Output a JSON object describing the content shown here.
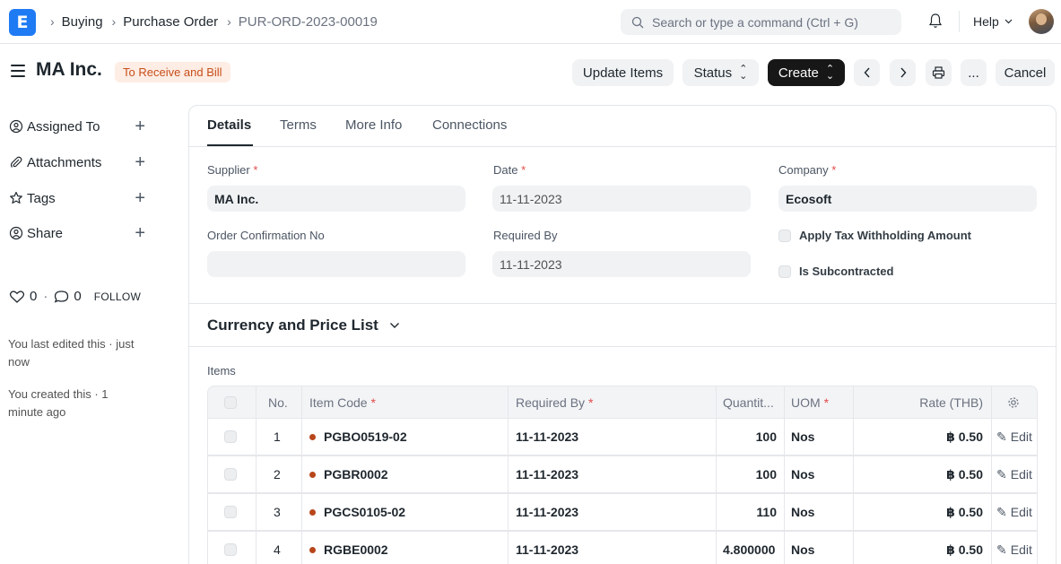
{
  "navbar": {
    "logo": "E",
    "breadcrumbs": [
      "Buying",
      "Purchase Order",
      "PUR-ORD-2023-00019"
    ],
    "search_placeholder": "Search or type a command (Ctrl + G)",
    "help_label": "Help"
  },
  "page": {
    "title": "MA Inc.",
    "status": "To Receive and Bill",
    "actions": {
      "update_items": "Update Items",
      "status": "Status",
      "create": "Create",
      "more": "...",
      "cancel": "Cancel"
    }
  },
  "sidebar": {
    "items": [
      {
        "label": "Assigned To"
      },
      {
        "label": "Attachments"
      },
      {
        "label": "Tags"
      },
      {
        "label": "Share"
      }
    ],
    "likes": "0",
    "comments": "0",
    "follow": "FOLLOW",
    "last_edited": "You last edited this · just now",
    "created": "You created this · 1 minute ago"
  },
  "tabs": [
    "Details",
    "Terms",
    "More Info",
    "Connections"
  ],
  "form": {
    "supplier_label": "Supplier",
    "supplier": "MA Inc.",
    "date_label": "Date",
    "date": "11-11-2023",
    "company_label": "Company",
    "company": "Ecosoft",
    "order_conf_label": "Order Confirmation No",
    "order_conf": "",
    "required_by_label": "Required By",
    "required_by": "11-11-2023",
    "apply_tax_label": "Apply Tax Withholding Amount",
    "subcontracted_label": "Is Subcontracted",
    "required_mark": "*"
  },
  "section": {
    "currency_title": "Currency and Price List"
  },
  "items": {
    "label": "Items",
    "columns": {
      "no": "No.",
      "item_code": "Item Code",
      "required_by": "Required By",
      "quantity": "Quantit...",
      "uom": "UOM",
      "rate": "Rate (THB)"
    },
    "rows": [
      {
        "no": "1",
        "item_code": "PGBO0519-02",
        "required_by": "11-11-2023",
        "qty": "100",
        "uom": "Nos",
        "rate": "฿ 0.50",
        "edit": "Edit"
      },
      {
        "no": "2",
        "item_code": "PGBR0002",
        "required_by": "11-11-2023",
        "qty": "100",
        "uom": "Nos",
        "rate": "฿ 0.50",
        "edit": "Edit"
      },
      {
        "no": "3",
        "item_code": "PGCS0105-02",
        "required_by": "11-11-2023",
        "qty": "110",
        "uom": "Nos",
        "rate": "฿ 0.50",
        "edit": "Edit"
      },
      {
        "no": "4",
        "item_code": "RGBE0002",
        "required_by": "11-11-2023",
        "qty": "4.800000",
        "uom": "Nos",
        "rate": "฿ 0.50",
        "edit": "Edit"
      }
    ]
  },
  "colors": {
    "accent": "#1f7bf4",
    "indicator_bg": "#fdede4",
    "indicator_text": "#c84e1b",
    "dark_button": "#171717"
  }
}
